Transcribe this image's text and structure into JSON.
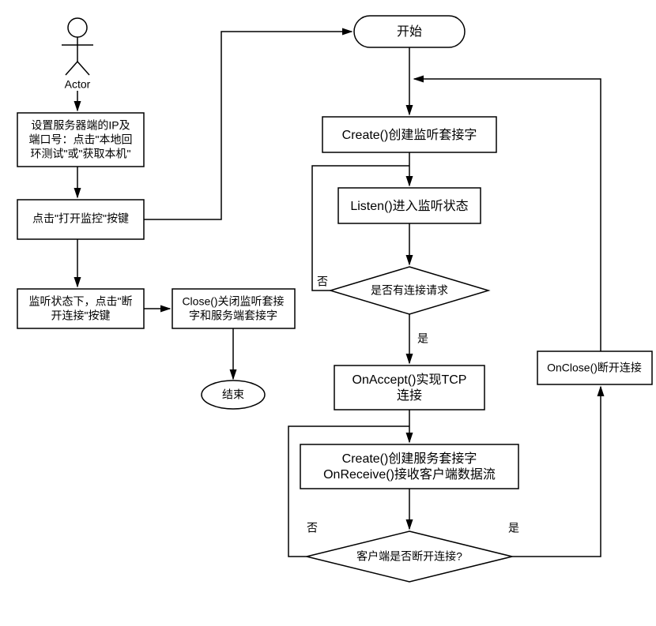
{
  "diagram": {
    "actor_label": "Actor",
    "start": "开始",
    "create_listen_socket": "Create()创建监听套接字",
    "listen_state": "Listen()进入监听状态",
    "has_conn_request": "是否有连接请求",
    "on_accept": "OnAccept()实现TCP连接",
    "on_accept_l1": "OnAccept()实现TCP",
    "on_accept_l2": "连接",
    "create_service": "Create()创建服务套接字",
    "on_receive": "OnReceive()接收客户端数据流",
    "client_disconnected": "客户端是否断开连接?",
    "on_close": "OnClose()断开连接",
    "set_ip_l1": "设置服务器端的IP及",
    "set_ip_l2": "端口号：点击\"本地回",
    "set_ip_l3": "环测试\"或\"获取本机\"",
    "open_monitor": "点击\"打开监控\"按键",
    "disconnect_l1": "监听状态下，点击\"断",
    "disconnect_l2": "开连接\"按键",
    "close_socket_l1": "Close()关闭监听套接",
    "close_socket_l2": "字和服务端套接字",
    "end": "结束",
    "yes": "是",
    "no": "否"
  }
}
